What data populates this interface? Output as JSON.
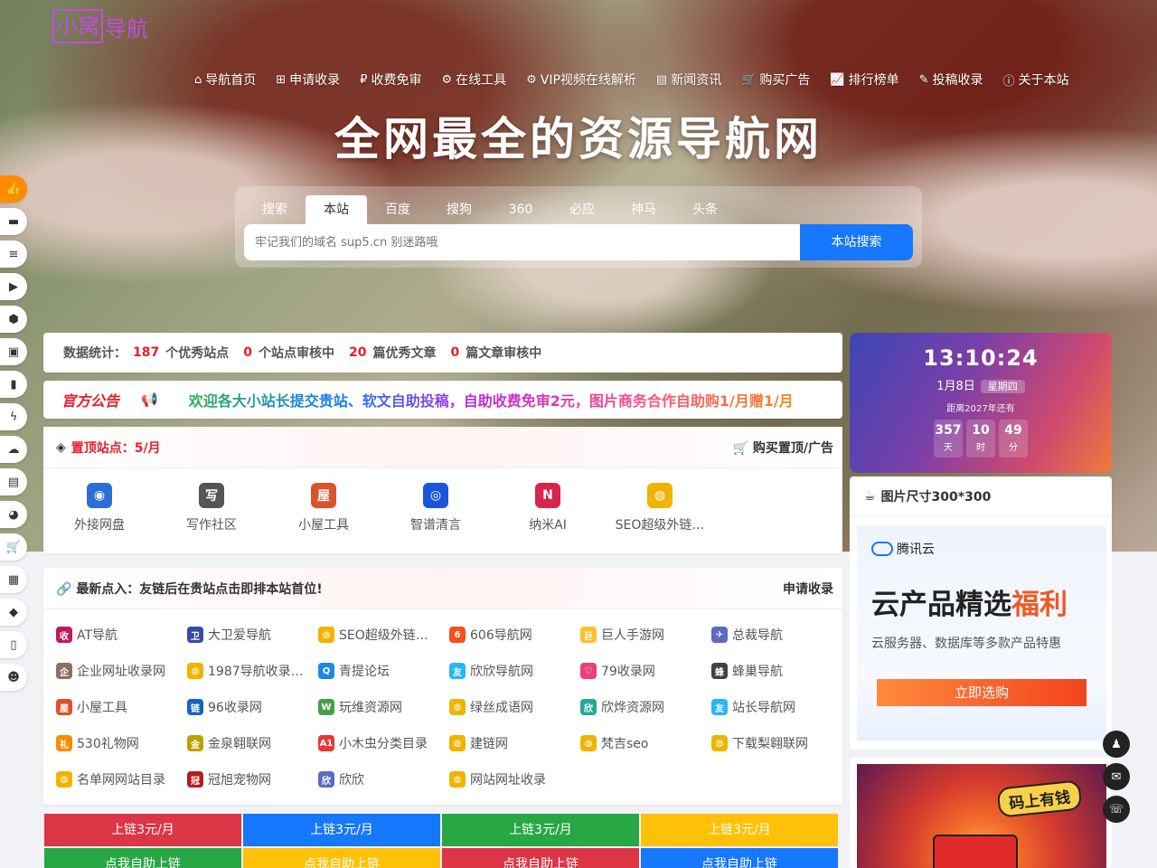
{
  "logo": {
    "box": "小窝",
    "text": "导航"
  },
  "nav": [
    {
      "icon": "home-icon",
      "glyph": "⌂",
      "label": "导航首页"
    },
    {
      "icon": "plus-square-icon",
      "glyph": "⊞",
      "label": "申请收录"
    },
    {
      "icon": "ruble-icon",
      "glyph": "₽",
      "label": "收费免审"
    },
    {
      "icon": "cogs-icon",
      "glyph": "⚙",
      "label": "在线工具"
    },
    {
      "icon": "gear-icon",
      "glyph": "⚙",
      "label": "VIP视频在线解析"
    },
    {
      "icon": "newspaper-icon",
      "glyph": "▤",
      "label": "新闻资讯"
    },
    {
      "icon": "cart-icon",
      "glyph": "🛒",
      "label": "购买广告"
    },
    {
      "icon": "line-chart-icon",
      "glyph": "📈",
      "label": "排行榜单"
    },
    {
      "icon": "edit-icon",
      "glyph": "✎",
      "label": "投稿收录"
    },
    {
      "icon": "info-circle-icon",
      "glyph": "ⓘ",
      "label": "关于本站"
    }
  ],
  "headline": "全网最全的资源导航网",
  "search": {
    "tabs": [
      "搜索",
      "本站",
      "百度",
      "搜狗",
      "360",
      "必应",
      "神马",
      "头条"
    ],
    "active_tab": "本站",
    "placeholder": "牢记我们的域名 sup5.cn 别迷路哦",
    "button": "本站搜索"
  },
  "stats": {
    "prefix": "数据统计：",
    "sites": "187",
    "sites_label": "个优秀站点",
    "pending_sites": "0",
    "pending_sites_label": "个站点审核中",
    "articles": "20",
    "articles_label": "篇优秀文章",
    "pending_articles": "0",
    "pending_articles_label": "篇文章审核中"
  },
  "notice": {
    "badge": "官方公告",
    "text": "欢迎各大小站长提交贵站、软文自助投稿，自助收费免审2元，图片商务合作自助购1/月赠1/月"
  },
  "top_sites": {
    "title": "置顶站点：5/月",
    "buy": "购买置顶/广告",
    "items": [
      {
        "label": "外接网盘",
        "color": "#2b6fd6",
        "glyph": "◉"
      },
      {
        "label": "写作社区",
        "color": "#555555",
        "glyph": "写"
      },
      {
        "label": "小屋工具",
        "color": "#d9532c",
        "glyph": "屋"
      },
      {
        "label": "智谱清言",
        "color": "#1a56db",
        "glyph": "◎"
      },
      {
        "label": "纳米AI",
        "color": "#d8254a",
        "glyph": "N"
      },
      {
        "label": "SEO超级外链…",
        "color": "#f0b400",
        "glyph": "◍"
      }
    ]
  },
  "latest": {
    "title": "最新点入：友链后在贵站点击即排本站首位!",
    "apply": "申请收录",
    "items": [
      {
        "label": "AT导航",
        "color": "#c2185b",
        "glyph": "收"
      },
      {
        "label": "大卫爱导航",
        "color": "#3949ab",
        "glyph": "卫"
      },
      {
        "label": "SEO超级外链…",
        "color": "#f0b400",
        "glyph": "◍"
      },
      {
        "label": "606导航网",
        "color": "#f4511e",
        "glyph": "6"
      },
      {
        "label": "巨人手游网",
        "color": "#fbc02d",
        "glyph": "巨"
      },
      {
        "label": "总裁导航",
        "color": "#5c6bc0",
        "glyph": "✈"
      },
      {
        "label": "企业网址收录网",
        "color": "#8d6e63",
        "glyph": "企"
      },
      {
        "label": "1987导航收录…",
        "color": "#f0b400",
        "glyph": "◍"
      },
      {
        "label": "青提论坛",
        "color": "#1e88e5",
        "glyph": "Q"
      },
      {
        "label": "欣欣导航网",
        "color": "#29b6f6",
        "glyph": "友"
      },
      {
        "label": "79收录网",
        "color": "#ec407a",
        "glyph": "♡"
      },
      {
        "label": "蜂巢导航",
        "color": "#424242",
        "glyph": "蜂"
      },
      {
        "label": "小屋工具",
        "color": "#d9532c",
        "glyph": "屋"
      },
      {
        "label": "96收录网",
        "color": "#1565c0",
        "glyph": "链"
      },
      {
        "label": "玩维资源网",
        "color": "#43a047",
        "glyph": "W"
      },
      {
        "label": "绿丝成语网",
        "color": "#f0b400",
        "glyph": "◍"
      },
      {
        "label": "欣烨资源网",
        "color": "#26a69a",
        "glyph": "欣"
      },
      {
        "label": "站长导航网",
        "color": "#29b6f6",
        "glyph": "友"
      },
      {
        "label": "530礼物网",
        "color": "#fb8c00",
        "glyph": "礼"
      },
      {
        "label": "金泉翱联网",
        "color": "#c0a000",
        "glyph": "金"
      },
      {
        "label": "小木虫分类目录",
        "color": "#e53935",
        "glyph": "A1"
      },
      {
        "label": "建链网",
        "color": "#f0b400",
        "glyph": "◍"
      },
      {
        "label": "梵吉seo",
        "color": "#f0b400",
        "glyph": "◍"
      },
      {
        "label": "下载梨翱联网",
        "color": "#f0b400",
        "glyph": "◍"
      },
      {
        "label": "名单网网站目录",
        "color": "#f0b400",
        "glyph": "◍"
      },
      {
        "label": "冠旭宠物网",
        "color": "#b71c1c",
        "glyph": "冠"
      },
      {
        "label": "欣欣",
        "color": "#5c6bc0",
        "glyph": "欣"
      },
      {
        "label": "网站网址收录",
        "color": "#f0b400",
        "glyph": "◍"
      }
    ]
  },
  "ads": [
    {
      "label": "上链3元/月",
      "color": "#dc3545"
    },
    {
      "label": "上链3元/月",
      "color": "#1677ff"
    },
    {
      "label": "上链3元/月",
      "color": "#28a745"
    },
    {
      "label": "上链3元/月",
      "color": "#ffc107"
    },
    {
      "label": "点我自助上链",
      "color": "#28a745"
    },
    {
      "label": "点我自助上链",
      "color": "#ffc107"
    },
    {
      "label": "点我自助上链",
      "color": "#dc3545"
    },
    {
      "label": "点我自助上链",
      "color": "#1677ff"
    }
  ],
  "clock": {
    "time": "13:10:24",
    "date": "1月8日",
    "weekday": "星期四",
    "until": "距离2027年还有",
    "days": "357",
    "days_label": "天",
    "hours": "10",
    "hours_label": "时",
    "minutes": "49",
    "minutes_label": "分"
  },
  "side_ad": {
    "title": "图片尺寸300*300",
    "brand": "腾讯云",
    "big": "云产品精选",
    "big_accent": "福利",
    "sub": "云服务器、数据库等多款产品特惠",
    "cta": "立即选购"
  },
  "promo": {
    "tag": "码上有钱"
  },
  "left_bar": [
    "thumbs-up-icon",
    "file-icon",
    "database-icon",
    "youtube-icon",
    "cube-icon",
    "image-icon",
    "bookmark-icon",
    "bolt-icon",
    "cloud-icon",
    "document-icon",
    "pie-icon",
    "cart-icon",
    "clipboard-icon",
    "gamepad-icon",
    "book-icon",
    "snapchat-icon"
  ],
  "right_bar": [
    "qq-icon",
    "mail-icon",
    "wechat-icon"
  ]
}
